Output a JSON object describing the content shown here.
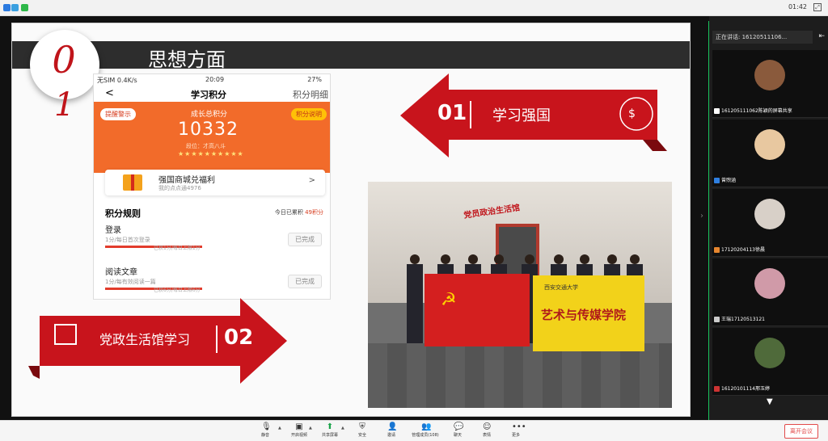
{
  "topbar": {
    "clock": "01:42"
  },
  "slide": {
    "title": "思想方面",
    "badge_top": "0",
    "badge_bottom": "1",
    "banner_right": {
      "num": "01",
      "text": "学习强国"
    },
    "banner_left": {
      "num": "02",
      "text": "党政生活馆学习"
    }
  },
  "phone": {
    "status_left": "无SIM 0.4K/s",
    "status_mid": "20:09",
    "status_right": "27%",
    "nav_back": "<",
    "nav_title": "学习积分",
    "nav_right": "积分明细",
    "alert_tag": "提醒警示",
    "rule_tag": "积分说明",
    "score_label": "成长总积分",
    "score_value": "10332",
    "rank": "段位：才高八斗",
    "stars": "★★★★★★★★★★",
    "mall_title": "强国商城兑福利",
    "mall_sub": "我的点点通4976",
    "mall_arrow": ">",
    "rules_title": "积分规则",
    "today_prefix": "今日已累积",
    "today_points": "49积分",
    "rules": [
      {
        "name": "登录",
        "desc": "1分/每日首次登录",
        "progress_text": "已获1分/每日上限1分",
        "progress": 1.0,
        "status": "已完成"
      },
      {
        "name": "阅读文章",
        "desc": "1分/每有效阅读一篇",
        "progress_text": "已获6分/每日上限6分",
        "progress": 1.0,
        "status": "已完成"
      }
    ]
  },
  "photo": {
    "sign": "党员政治生活馆",
    "flag_yellow_top": "西安交通大学",
    "flag_yellow_text": "艺术与传媒学院"
  },
  "panel": {
    "speaking": "正在讲话: 16120511106...",
    "participants": [
      {
        "label": "161205111062陈颖的屏幕共享",
        "avatar_color": "#8a5a3c"
      },
      {
        "label": "曾煦涵",
        "avatar_color": "#e8c8a0"
      },
      {
        "label": "17120204113徐晨",
        "avatar_color": "#d8d0c8"
      },
      {
        "label": "王瑞17120513121",
        "avatar_color": "#d09aa8"
      },
      {
        "label": "16120101114邢玉婷",
        "avatar_color": "#4f6a3a"
      }
    ]
  },
  "toolbar": {
    "items": [
      "静音",
      "开启视频",
      "共享屏幕",
      "安全",
      "邀请",
      "管理成员(108)",
      "聊天",
      "表情",
      "更多"
    ],
    "leave": "离开会议"
  }
}
